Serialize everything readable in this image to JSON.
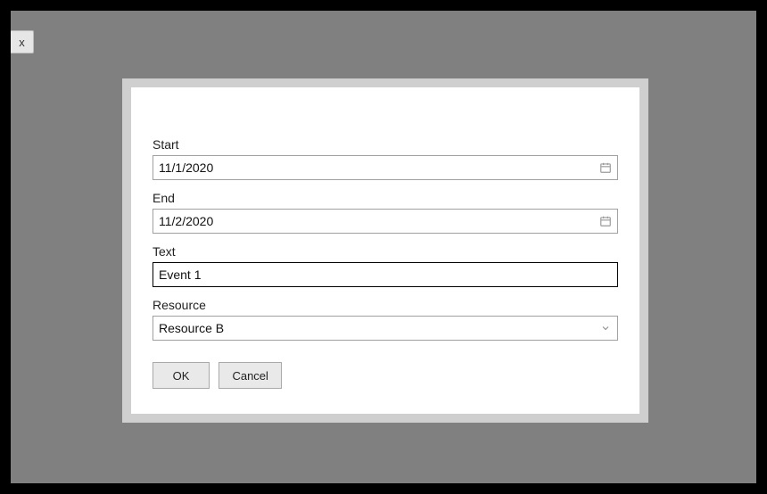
{
  "background": {
    "fragment_button_text": "x"
  },
  "form": {
    "start": {
      "label": "Start",
      "value": "11/1/2020"
    },
    "end": {
      "label": "End",
      "value": "11/2/2020"
    },
    "text": {
      "label": "Text",
      "value": "Event 1"
    },
    "resource": {
      "label": "Resource",
      "value": "Resource B"
    }
  },
  "buttons": {
    "ok": "OK",
    "cancel": "Cancel"
  }
}
